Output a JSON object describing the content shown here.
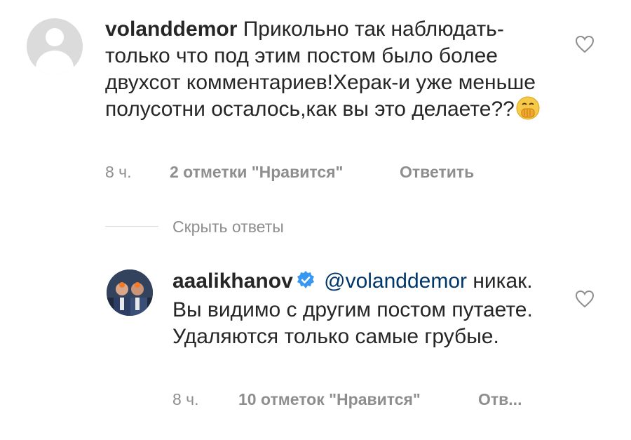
{
  "comments": [
    {
      "username": "volanddemor",
      "text": "Прикольно так наблюдать- только что под этим постом было более двухсот комментариев!Херак-и уже меньше полусотни осталось,как вы это делаете??",
      "emoji": "face-with-hand-over-mouth-emoji",
      "time": "8 ч.",
      "likes": "2 отметки \"Нравится\"",
      "reply_label": "Ответить",
      "avatar": "default-avatar-icon"
    },
    {
      "username": "aaalikhanov",
      "verified": true,
      "mention": "@volanddemor",
      "text": "никак. Вы видимо с другим постом путаете. Удаляются только самые грубые.",
      "time": "8 ч.",
      "likes": "10 отметок \"Нравится\"",
      "reply_label": "Отв...",
      "avatar": "profile-photo"
    }
  ],
  "replies_toggle": {
    "label": "Скрыть ответы"
  },
  "colors": {
    "text": "#262626",
    "muted": "#8e8e8e",
    "mention": "#00376b",
    "verified": "#3897f0",
    "divider": "#dbdbdb"
  }
}
